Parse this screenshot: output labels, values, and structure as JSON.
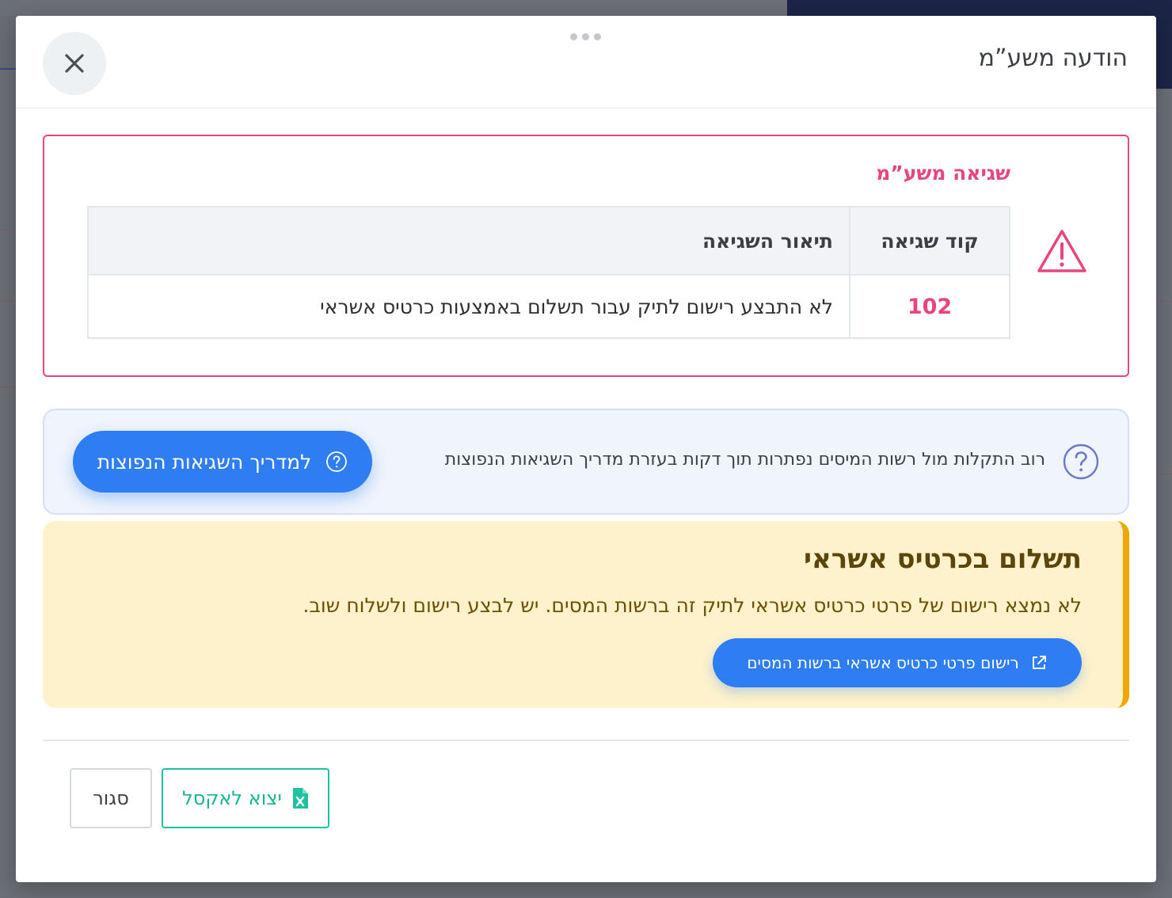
{
  "modal": {
    "title": "הודעה משע”מ"
  },
  "error": {
    "title": "שגיאה משע”מ",
    "table": {
      "headers": [
        "קוד שגיאה",
        "תיאור השגיאה"
      ],
      "rows": [
        {
          "code": "102",
          "description": "לא התבצע רישום לתיק עבור תשלום באמצעות כרטיס אשראי"
        }
      ]
    }
  },
  "help": {
    "text": "רוב התקלות מול רשות המיסים נפתרות תוך דקות בעזרת מדריך השגיאות הנפוצות",
    "button_label": "למדריך השגיאות הנפוצות"
  },
  "credit_card": {
    "title": "תשלום בכרטיס אשראי",
    "text": "לא נמצא רישום של פרטי כרטיס אשראי לתיק זה ברשות המסים. יש לבצע רישום ולשלוח שוב.",
    "button_label": "רישום פרטי כרטיס אשראי ברשות המסים"
  },
  "footer": {
    "excel_label": "יצוא לאקסל",
    "close_label": "סגור"
  },
  "colors": {
    "error_accent": "#e8457e",
    "primary_blue": "#2f7df2",
    "warning_bg": "#fdf2cc",
    "warning_border": "#f0a800",
    "excel_green": "#1fc3a0"
  },
  "icons": {
    "close": "close-icon",
    "warning": "warning-triangle-icon",
    "help": "question-circle-icon",
    "external": "external-link-icon",
    "excel": "excel-file-icon"
  }
}
